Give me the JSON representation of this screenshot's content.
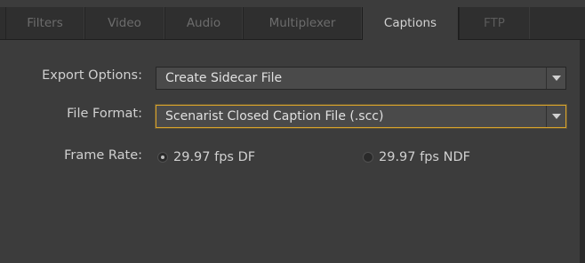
{
  "tabs": [
    {
      "label": "Filters"
    },
    {
      "label": "Video"
    },
    {
      "label": "Audio"
    },
    {
      "label": "Multiplexer"
    },
    {
      "label": "Captions"
    },
    {
      "label": "FTP"
    }
  ],
  "active_tab": "Captions",
  "export_options": {
    "label": "Export Options:",
    "value": "Create Sidecar File"
  },
  "file_format": {
    "label": "File Format:",
    "value": "Scenarist Closed Caption File (.scc)"
  },
  "frame_rate": {
    "label": "Frame Rate:",
    "options": [
      {
        "label": "29.97 fps DF",
        "selected": true
      },
      {
        "label": "29.97 fps NDF",
        "selected": false
      }
    ]
  },
  "colors": {
    "focus_border": "#d7a22b",
    "panel_bg": "#3c3c3c",
    "tabbar_bg": "#2e2e2e"
  }
}
